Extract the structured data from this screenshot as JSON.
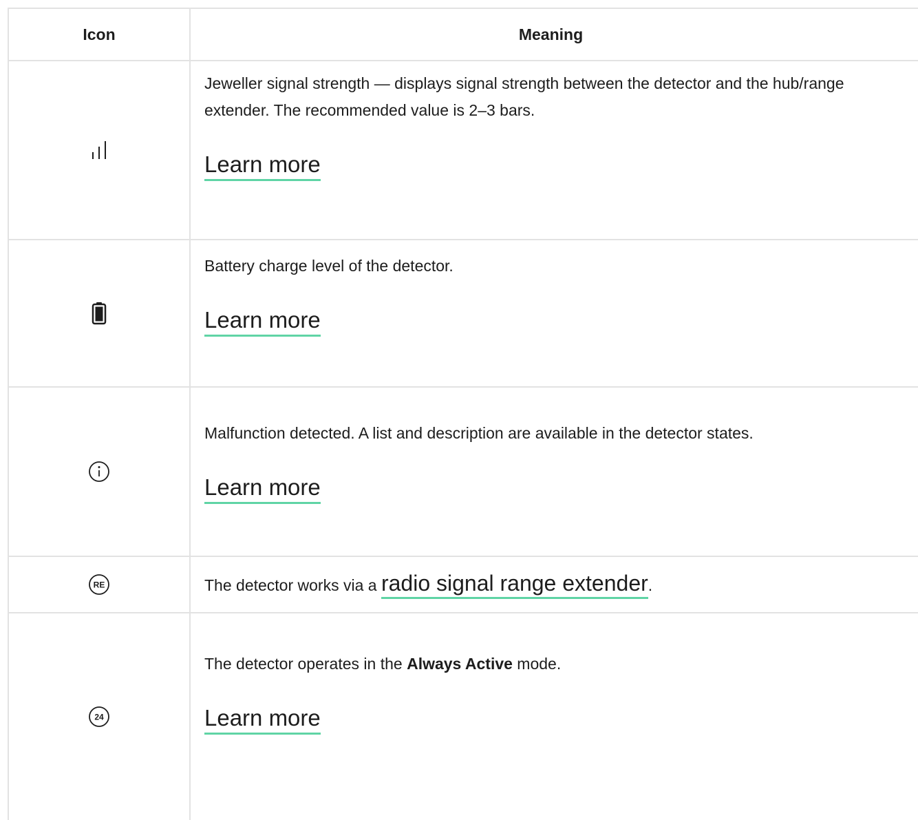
{
  "header": {
    "icon_label": "Icon",
    "meaning_label": "Meaning"
  },
  "rows": [
    {
      "icon": "signal-strength-icon",
      "text": "Jeweller signal strength — displays signal strength between the detector and the hub/range extender. The recommended value is 2–3 bars.",
      "link": "Learn more"
    },
    {
      "icon": "battery-icon",
      "text": "Battery charge level of the detector.",
      "link": "Learn more"
    },
    {
      "icon": "info-circle-icon",
      "text": "Malfunction detected. A list and description are available in the detector states.",
      "link": "Learn more"
    },
    {
      "icon": "range-extender-icon",
      "icon_text": "RE",
      "text_before": "The detector works via a ",
      "link": "radio signal range extender",
      "text_after": "."
    },
    {
      "icon": "always-active-24-icon",
      "icon_text": "24",
      "text_before": "The detector operates in the ",
      "bold": "Always Active",
      "text_after": " mode.",
      "link": "Learn more"
    }
  ],
  "colors": {
    "border": "#e2e2e2",
    "link_underline": "#5fd4a5",
    "text": "#1d1d1d"
  }
}
